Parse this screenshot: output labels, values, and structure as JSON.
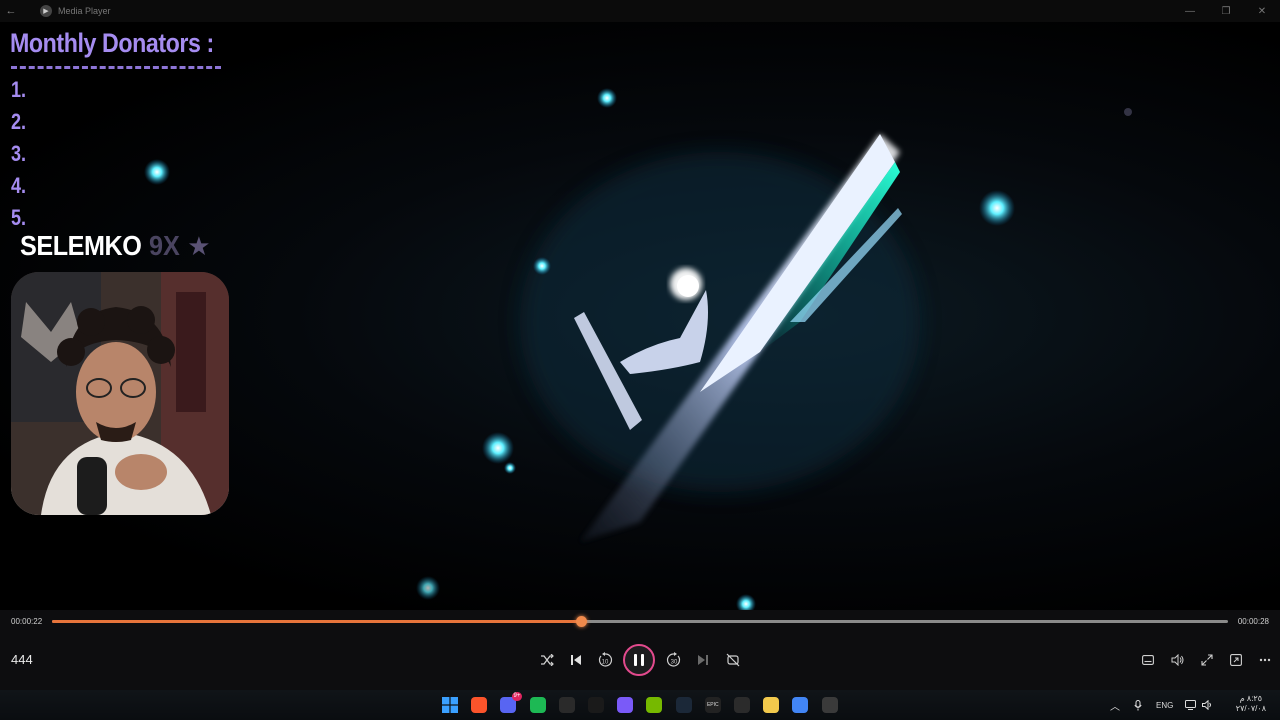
{
  "window": {
    "title": "Media Player",
    "back_glyph": "←",
    "min_glyph": "—",
    "max_glyph": "❐",
    "close_glyph": "✕"
  },
  "overlay": {
    "donators_title": "Monthly Donators :",
    "donators": [
      "1.",
      "2.",
      "3.",
      "4.",
      "5."
    ],
    "brand_name": "SELEMKO",
    "brand_mark": "9X",
    "brand_star": "★"
  },
  "player": {
    "current_time": "00:00:22",
    "total_time": "00:00:28",
    "progress_fraction": 0.45,
    "media_title": "444",
    "accent": "#e7743b",
    "play_ring": "#e24a8d",
    "skip_back_label": "10",
    "skip_fwd_label": "30"
  },
  "taskbar": {
    "apps": [
      {
        "name": "windows-start-icon",
        "color": "#3aa0ff"
      },
      {
        "name": "brave-browser-icon",
        "color": "#fb542b"
      },
      {
        "name": "discord-icon",
        "color": "#5865f2",
        "badge": "9+"
      },
      {
        "name": "spotify-icon",
        "color": "#1db954"
      },
      {
        "name": "xbox-icon",
        "color": "#2a2a2a"
      },
      {
        "name": "logitech-ghub-icon",
        "color": "#1a1a1a"
      },
      {
        "name": "copilot-icon",
        "color": "#7a5af8"
      },
      {
        "name": "nvidia-icon",
        "color": "#76b900"
      },
      {
        "name": "steam-icon",
        "color": "#1b2838"
      },
      {
        "name": "epic-games-icon",
        "color": "#222222"
      },
      {
        "name": "obs-icon",
        "color": "#2b2b2b"
      },
      {
        "name": "file-explorer-icon",
        "color": "#f2c94c"
      },
      {
        "name": "chrome-icon",
        "color": "#4285f4"
      },
      {
        "name": "media-player-icon",
        "color": "#3a3a3a"
      }
    ],
    "epic_label": "EPIC",
    "language": "ENG",
    "clock_time": "٨:٢٥ م",
    "clock_date": "٢٧/٠٧/٠٨"
  }
}
